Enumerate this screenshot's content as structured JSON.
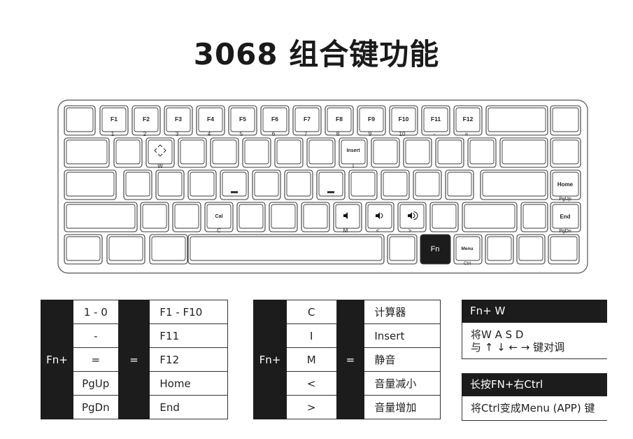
{
  "title": "3068 组合键功能",
  "keyboard": {
    "row1": {
      "fkeys": [
        "F1",
        "F2",
        "F3",
        "F4",
        "F5",
        "F6",
        "F7",
        "F8",
        "F9",
        "F10",
        "F11",
        "F12"
      ],
      "subs": [
        "1",
        "2",
        "3",
        "4",
        "5",
        "6",
        "7",
        "8",
        "9",
        "10",
        "-",
        "="
      ]
    },
    "w_sub": "W",
    "insert": "Insert",
    "insert_sub": "I",
    "home": "Home",
    "home_sub": "PgUp",
    "cal": "Cal",
    "cal_sub": "C",
    "mute_sub": "M",
    "voldown_sub": "<",
    "volup_sub": ">",
    "end": "End",
    "end_sub": "PgDn",
    "fn": "Fn",
    "menu": "Menu",
    "menu_sub": "Ctrl"
  },
  "table1": {
    "prefix": "Fn+",
    "eq": "=",
    "rows": [
      {
        "key": "1 - 0",
        "value": "F1 - F10"
      },
      {
        "key": "-",
        "value": "F11"
      },
      {
        "key": "=",
        "value": "F12"
      },
      {
        "key": "PgUp",
        "value": "Home"
      },
      {
        "key": "PgDn",
        "value": "End"
      }
    ]
  },
  "table2": {
    "prefix": "Fn+",
    "eq": "=",
    "rows": [
      {
        "key": "C",
        "value": "计算器"
      },
      {
        "key": "I",
        "value": "Insert"
      },
      {
        "key": "M",
        "value": "静音"
      },
      {
        "key": "<",
        "value": "音量减小"
      },
      {
        "key": ">",
        "value": "音量增加"
      }
    ]
  },
  "note1": {
    "header": "Fn+ W",
    "line1": "将W A S D",
    "line2": "与 ↑ ↓ ← → 键对调"
  },
  "note2": {
    "header": "长按FN+右Ctrl",
    "line1": "将Ctrl变成Menu (APP) 键"
  },
  "colors": {
    "key_outline": "#3a3a3a",
    "dark_fill": "#1c1c1c",
    "background": "#ffffff"
  }
}
